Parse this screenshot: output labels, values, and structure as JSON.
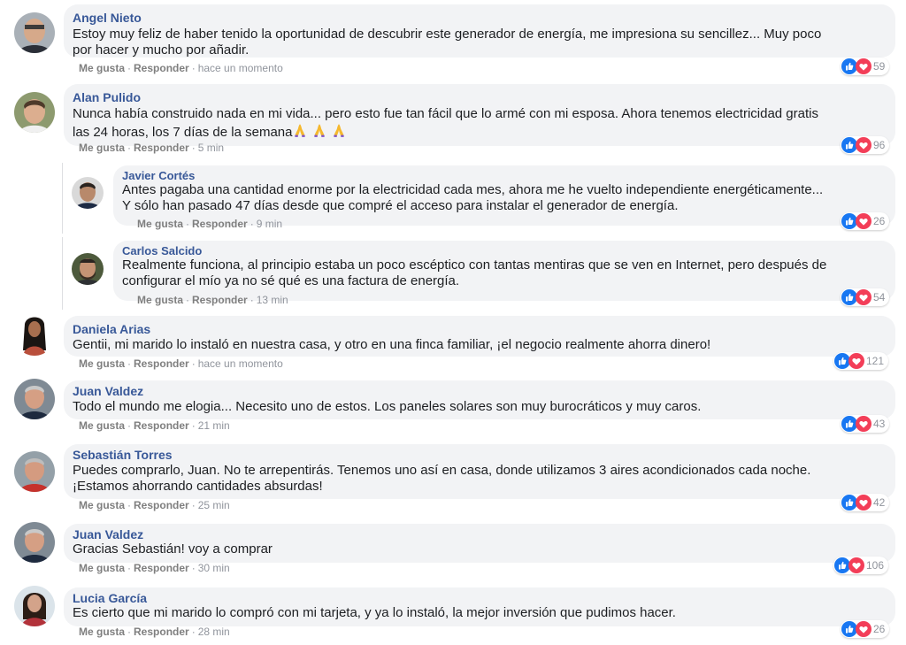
{
  "labels": {
    "like": "Me gusta",
    "reply": "Responder",
    "sep": "·"
  },
  "colors": {
    "name": "#385898",
    "bubble": "#f2f3f5",
    "like_blue": "#1877f2",
    "love_red": "#f33e58"
  },
  "comments": [
    {
      "author": "Angel Nieto",
      "lines": [
        "Estoy muy feliz de haber tenido la oportunidad de descubrir este generador de energía, me impresiona su sencillez... Muy poco",
        "por hacer y mucho por añadir."
      ],
      "time": "hace un momento",
      "count": "59"
    },
    {
      "author": "Alan Pulido",
      "lines": [
        "Nunca había construido nada en mi vida... pero esto fue tan fácil que lo armé con mi esposa. Ahora tenemos electricidad gratis",
        "las 24 horas, los 7 días de la semana"
      ],
      "emoji_icons": [
        "praying-hands-icon",
        "praying-hands-icon",
        "praying-hands-icon"
      ],
      "time": "5 min",
      "count": "96"
    },
    {
      "author": "Javier Cortés",
      "lines": [
        "Antes pagaba una cantidad enorme por la electricidad cada mes, ahora me he vuelto independiente energéticamente...",
        "Y sólo han pasado 47 días desde que compré el acceso para instalar el generador de energía."
      ],
      "time": "9 min",
      "count": "26"
    },
    {
      "author": "Carlos Salcido",
      "lines": [
        "Realmente funciona, al principio estaba un poco escéptico con tantas mentiras que se ven en Internet, pero después de",
        "configurar el mío ya no sé qué es una factura de energía."
      ],
      "time": "13 min",
      "count": "54"
    },
    {
      "author": "Daniela Arias",
      "lines": [
        "Gentii, mi marido lo instaló en nuestra casa, y otro en una finca familiar, ¡el negocio realmente ahorra dinero!"
      ],
      "time": "hace un momento",
      "count": "121"
    },
    {
      "author": "Juan Valdez",
      "lines": [
        "Todo el mundo me elogia... Necesito uno de estos. Los paneles solares son muy burocráticos y muy caros."
      ],
      "time": "21 min",
      "count": "43"
    },
    {
      "author": "Sebastián Torres",
      "lines": [
        "Puedes comprarlo, Juan. No te arrepentirás. Tenemos uno así en casa, donde utilizamos 3 aires acondicionados cada noche.",
        "¡Estamos ahorrando cantidades absurdas!"
      ],
      "time": "25 min",
      "count": "42"
    },
    {
      "author": "Juan Valdez",
      "lines": [
        "Gracias Sebastián! voy a comprar"
      ],
      "time": "30 min",
      "count": "106"
    },
    {
      "author": "Lucia García",
      "lines": [
        "Es cierto que mi marido lo compró con mi tarjeta, y ya lo instaló, la mejor inversión que pudimos hacer."
      ],
      "time": "28 min",
      "count": "26"
    }
  ]
}
